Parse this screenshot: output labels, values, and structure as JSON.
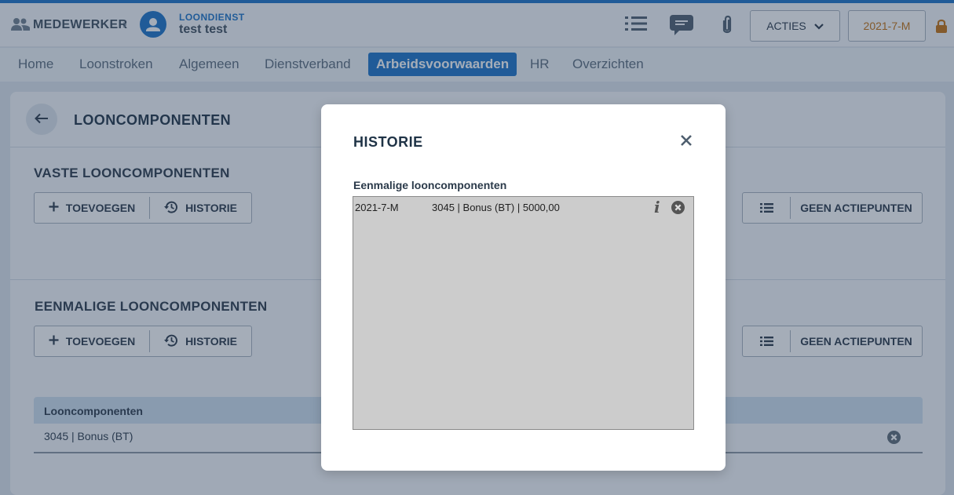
{
  "header": {
    "breadcrumb_label": "MEDEWERKER",
    "employee_supertitle": "LOONDIENST",
    "employee_name": "test test",
    "actions_label": "ACTIES",
    "period_label": "2021-7-M"
  },
  "nav": {
    "tabs": [
      {
        "label": "Home"
      },
      {
        "label": "Loonstroken"
      },
      {
        "label": "Algemeen"
      },
      {
        "label": "Dienstverband"
      },
      {
        "label": "Arbeidsvoorwaarden",
        "active": true
      },
      {
        "label": "HR"
      },
      {
        "label": "Overzichten"
      }
    ]
  },
  "page": {
    "title": "LOONCOMPONENTEN",
    "fixed_section": {
      "title": "VASTE LOONCOMPONENTEN",
      "add_label": "TOEVOEGEN",
      "history_label": "HISTORIE",
      "actions_label": "GEEN ACTIEPUNTEN"
    },
    "onetime_section": {
      "title": "EENMALIGE LOONCOMPONENTEN",
      "add_label": "TOEVOEGEN",
      "history_label": "HISTORIE",
      "actions_label": "GEEN ACTIEPUNTEN",
      "table": {
        "column_header": "Looncomponenten",
        "rows": [
          {
            "label": "3045 | Bonus (BT)"
          }
        ]
      }
    }
  },
  "modal": {
    "title": "HISTORIE",
    "list_label": "Eenmalige looncomponenten",
    "items": [
      {
        "period": "2021-7-M",
        "description": "3045 | Bonus (BT) | 5000,00"
      }
    ]
  },
  "colors": {
    "accent": "#1a73c8",
    "period": "#c4700f",
    "lock": "#c4700f"
  },
  "icons": [
    "people-icon",
    "chevron-right-icon",
    "person-icon",
    "list-icon",
    "chat-icon",
    "paperclip-icon",
    "chevron-down-icon",
    "lock-icon",
    "arrow-left-icon",
    "plus-icon",
    "history-icon",
    "close-icon",
    "info-icon",
    "remove-circle-icon"
  ]
}
